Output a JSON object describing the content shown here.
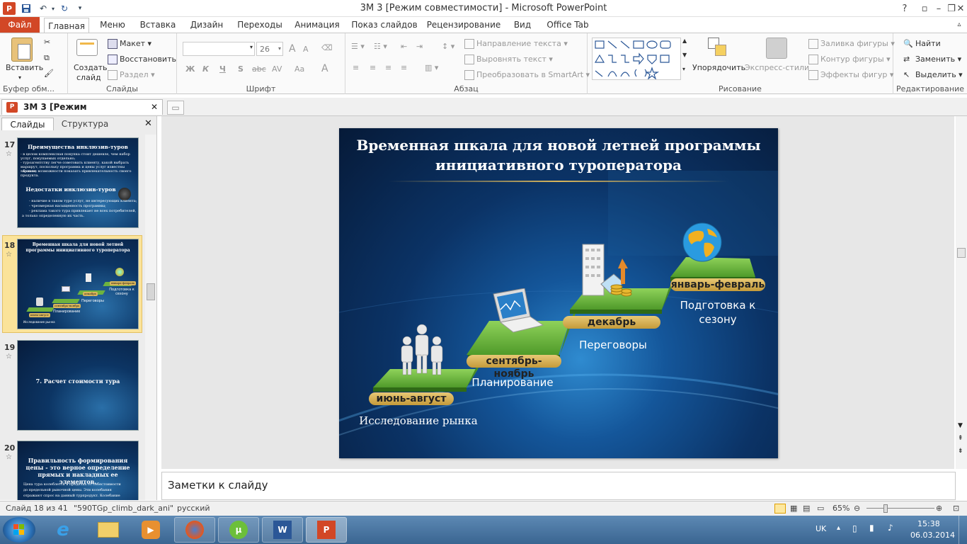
{
  "window": {
    "title": "3М 3 [Режим совместимости]  -  Microsoft PowerPoint"
  },
  "quick_access": {
    "undo": "↶",
    "redo": "↻"
  },
  "tabs": [
    {
      "label": "Файл"
    },
    {
      "label": "Главная"
    },
    {
      "label": "Меню"
    },
    {
      "label": "Вставка"
    },
    {
      "label": "Дизайн"
    },
    {
      "label": "Переходы"
    },
    {
      "label": "Анимация"
    },
    {
      "label": "Показ слайдов"
    },
    {
      "label": "Рецензирование"
    },
    {
      "label": "Вид"
    },
    {
      "label": "Office Tab"
    }
  ],
  "ribbon": {
    "clipboard": {
      "label": "Буфер обм...",
      "paste": "Вставить"
    },
    "slides": {
      "label": "Слайды",
      "new_slide_1": "Создать",
      "new_slide_2": "слайд",
      "layout": "Макет",
      "reset": "Восстановить",
      "section": "Раздел"
    },
    "font": {
      "label": "Шрифт",
      "size": "26",
      "bold": "Ж",
      "italic": "К",
      "underline": "Ч",
      "shadow": "S",
      "strike": "abc",
      "spacing": "AV",
      "case": "Aa",
      "color": "A",
      "grow": "A",
      "shrink": "A"
    },
    "paragraph": {
      "label": "Абзац",
      "direction": "Направление текста",
      "align_text": "Выровнять текст",
      "smartart": "Преобразовать в SmartArt"
    },
    "drawing": {
      "label": "Рисование",
      "arrange": "Упорядочить",
      "styles": "Экспресс-стили",
      "fill": "Заливка фигуры",
      "outline": "Контур фигуры",
      "effects": "Эффекты фигур"
    },
    "editing": {
      "label": "Редактирование",
      "find": "Найти",
      "replace": "Заменить",
      "select": "Выделить"
    }
  },
  "doc_tab": {
    "label": "3М 3 [Режим совместимости]"
  },
  "left_panel": {
    "tabs": [
      {
        "label": "Слайды"
      },
      {
        "label": "Структура"
      }
    ],
    "thumbs": [
      {
        "num": "17",
        "title1": "Преимущества инклюзив-туров",
        "title2": "Недостатки инклюзив-туров",
        "lines1": [
          "- в целом комплексная покупка стоит дешевле, чем набор",
          "  услуг, покупаемых отдельно;",
          "- туроагентству легче советовать клиенту, какой выбрать",
          "  маршрут, поскольку программа и цены услуг известны заранее;",
          "- больше возможности показать привлекательность своего",
          "  продукта."
        ],
        "lines2": [
          "- наличие в таком туре услуг, не интересующих клиента;",
          "- чрезмерная насыщенность программы;",
          "- реклама такого тура привлекает не всех потребителей,",
          "  а только определенную их часть."
        ]
      },
      {
        "num": "18",
        "title": "Временная шкала для новой летней программы инициативного туроператора",
        "pills": [
          "июнь-август",
          "сентябрь-ноябрь",
          "декабрь",
          "январь-февраль"
        ],
        "labels": [
          "Исследование рынка",
          "Планирование",
          "Переговоры",
          "Подготовка к сезону"
        ]
      },
      {
        "num": "19",
        "title": "7. Расчет стоимости тура"
      },
      {
        "num": "20",
        "title": "Правильность формирования цены - это верное определение прямых и накладных ее элементов.",
        "lines": [
          "Цена тура колеблется в пределах от себестоимости",
          "до предельной рыночной цены. Эти колебания",
          "отражают спрос на данный турпродукт. Колебание"
        ]
      }
    ]
  },
  "slide": {
    "title_line1": "Временная шкала для новой летней программы",
    "title_line2": "инициативного туроператора",
    "pills": [
      "июнь-август",
      "сентябрь-ноябрь",
      "декабрь",
      "январь-февраль"
    ],
    "labels": [
      "Исследование рынка",
      "Планирование",
      "Переговоры",
      "Подготовка  к сезону"
    ]
  },
  "notes": {
    "placeholder": "Заметки к слайду"
  },
  "status": {
    "slide": "Слайд 18 из 41",
    "theme": "\"590TGp_climb_dark_ani\"",
    "lang": "русский",
    "zoom": "65%"
  },
  "tray": {
    "lang": "UK",
    "time": "15:38",
    "date": "06.03.2014"
  },
  "colors": {
    "file_tab": "#d24726",
    "selected_thumb": "#fbe39a",
    "pill_gold": "#d9b55a",
    "step_green": "#6db33f"
  }
}
